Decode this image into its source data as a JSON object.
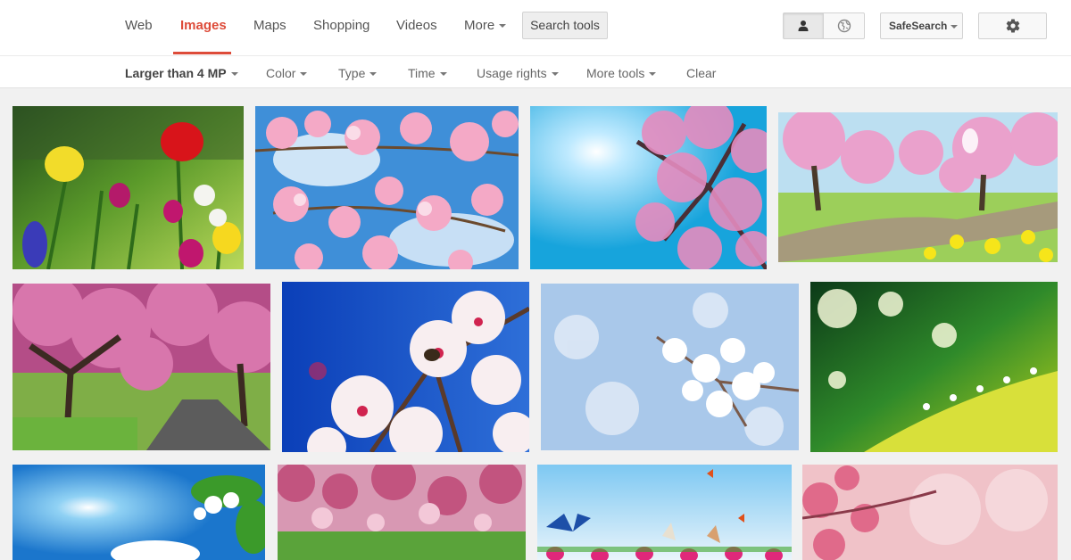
{
  "nav": {
    "tabs": [
      {
        "label": "Web"
      },
      {
        "label": "Images",
        "active": true
      },
      {
        "label": "Maps"
      },
      {
        "label": "Shopping"
      },
      {
        "label": "Videos"
      },
      {
        "label": "More",
        "dropdown": true
      }
    ],
    "search_tools_label": "Search tools",
    "safesearch_label": "SafeSearch",
    "icons": {
      "account": "person-icon",
      "region": "globe-icon",
      "settings": "gear-icon"
    },
    "accent_color": "#dd4b39"
  },
  "filters": [
    {
      "label": "Larger than 4 MP",
      "active": true
    },
    {
      "label": "Color"
    },
    {
      "label": "Type"
    },
    {
      "label": "Time"
    },
    {
      "label": "Usage rights"
    },
    {
      "label": "More tools"
    },
    {
      "label": "Clear",
      "dropdown": false
    }
  ],
  "results": {
    "count_visible": 12
  }
}
